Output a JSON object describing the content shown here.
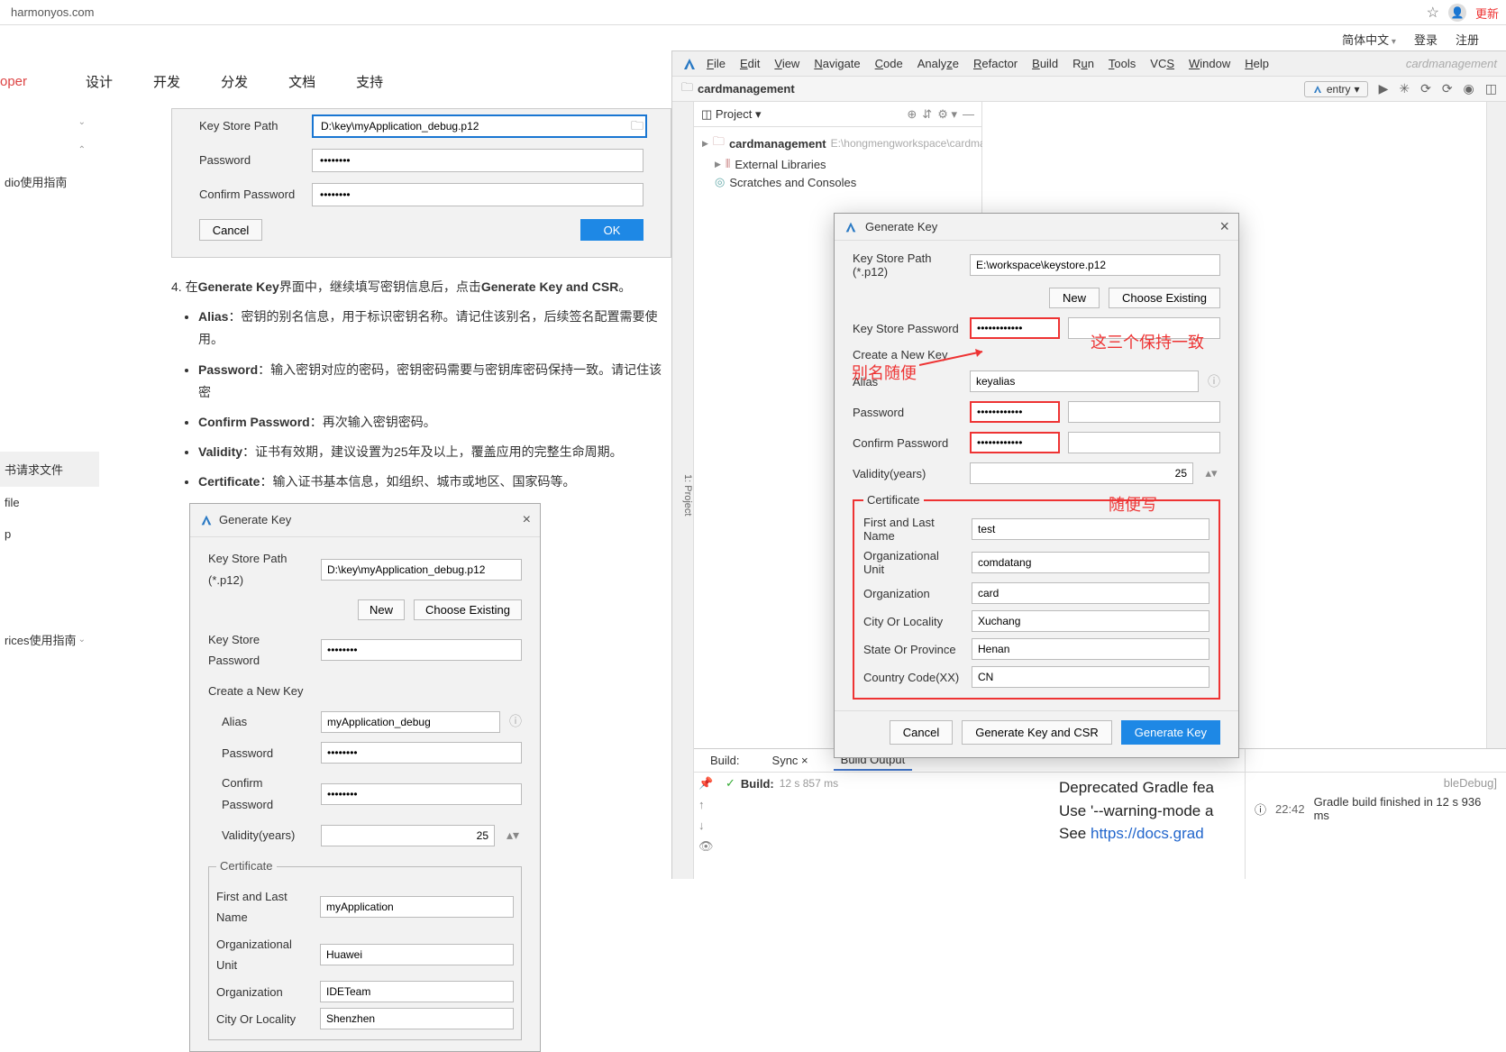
{
  "browser": {
    "url": "harmonyos.com",
    "update": "更新"
  },
  "top_nav": {
    "lang": "简体中文",
    "login": "登录",
    "register": "注册"
  },
  "dev_header": {
    "oper": "oper",
    "items": [
      "设计",
      "开发",
      "分发",
      "文档",
      "支持"
    ]
  },
  "left_sidebar": {
    "items": [
      {
        "label": "dio使用指南"
      },
      {
        "label": "书请求文件"
      },
      {
        "label": "file"
      },
      {
        "label": "p"
      },
      {
        "label": "rices使用指南"
      }
    ]
  },
  "doc": {
    "dialog1": {
      "label_keystore": "Key Store Path",
      "val_keystore": "D:\\key\\myApplication_debug.p12",
      "label_password": "Password",
      "val_password": "••••••••",
      "label_confirm": "Confirm Password",
      "val_confirm": "••••••••",
      "cancel": "Cancel",
      "ok": "OK"
    },
    "step_prefix": "4. 在",
    "step_bold1": "Generate Key",
    "step_mid": "界面中，继续填写密钥信息后，点击",
    "step_bold2": "Generate Key and CSR",
    "step_suffix": "。",
    "bullets": [
      {
        "b": "Alias",
        "t": "：密钥的别名信息，用于标识密钥名称。请记住该别名，后续签名配置需要使用。"
      },
      {
        "b": "Password",
        "t": "：输入密钥对应的密码，密钥密码需要与密钥库密码保持一致。请记住该密"
      },
      {
        "b": "Confirm Password",
        "t": "：再次输入密钥密码。"
      },
      {
        "b": "Validity",
        "t": "：证书有效期，建议设置为25年及以上，覆盖应用的完整生命周期。"
      },
      {
        "b": "Certificate",
        "t": "：输入证书基本信息，如组织、城市或地区、国家码等。"
      }
    ],
    "dialog2": {
      "title": "Generate Key",
      "label_keystore_path": "Key Store Path (*.p12)",
      "val_keystore_path": "D:\\key\\myApplication_debug.p12",
      "btn_new": "New",
      "btn_choose": "Choose Existing",
      "label_ks_password": "Key Store Password",
      "val_ks_password": "••••••••",
      "label_create": "Create a New Key",
      "label_alias": "Alias",
      "val_alias": "myApplication_debug",
      "label_password": "Password",
      "val_password": "••••••••",
      "label_confirm": "Confirm Password",
      "val_confirm": "••••••••",
      "label_validity": "Validity(years)",
      "val_validity": "25",
      "fieldset_title": "Certificate",
      "label_name": "First and Last Name",
      "val_name": "myApplication",
      "label_ou": "Organizational Unit",
      "val_ou": "Huawei",
      "label_org": "Organization",
      "val_org": "IDETeam",
      "label_city": "City Or Locality",
      "val_city": "Shenzhen"
    }
  },
  "ide": {
    "menu": [
      "File",
      "Edit",
      "View",
      "Navigate",
      "Code",
      "Analyze",
      "Refactor",
      "Build",
      "Run",
      "Tools",
      "VCS",
      "Window",
      "Help"
    ],
    "project_name": "cardmanagement",
    "breadcrumb": "cardmanagement",
    "run_config": "entry",
    "left_gutter": "1: Project",
    "project_header": "Project",
    "tree": {
      "root": "cardmanagement",
      "root_path": "E:\\hongmengworkspace\\cardmanagem",
      "ext_libs": "External Libraries",
      "scratches": "Scratches and Consoles"
    },
    "build": {
      "tab1": "Build:",
      "tab2": "Sync",
      "tab3": "Build Output",
      "status_label": "Build:",
      "status_time": "12 s 857 ms",
      "console_l1": "Deprecated Gradle fea",
      "console_l2": "Use '--warning-mode a",
      "console_l3": "See ",
      "console_link": "https://docs.grad",
      "right_badge": "bleDebug]",
      "right_time": "22:42",
      "right_msg": "Gradle build finished in 12 s 936 ms"
    }
  },
  "gen_dialog": {
    "title": "Generate Key",
    "label_path": "Key Store Path (*.p12)",
    "val_path": "E:\\workspace\\keystore.p12",
    "btn_new": "New",
    "btn_choose": "Choose Existing",
    "label_ks_pwd": "Key Store Password",
    "val_ks_pwd": "••••••••••••",
    "label_create": "Create a New Key",
    "label_alias": "Alias",
    "val_alias": "keyalias",
    "label_pwd": "Password",
    "val_pwd": "••••••••••••",
    "label_confirm": "Confirm Password",
    "val_confirm": "••••••••••••",
    "label_validity": "Validity(years)",
    "val_validity": "25",
    "fieldset_title": "Certificate",
    "label_name": "First and Last Name",
    "val_name": "test",
    "label_ou": "Organizational Unit",
    "val_ou": "comdatang",
    "label_org": "Organization",
    "val_org": "card",
    "label_city": "City Or Locality",
    "val_city": "Xuchang",
    "label_state": "State Or Province",
    "val_state": "Henan",
    "label_country": "Country Code(XX)",
    "val_country": "CN",
    "btn_cancel": "Cancel",
    "btn_gen_csr": "Generate Key and CSR",
    "btn_gen": "Generate Key"
  },
  "annotations": {
    "a1": "这三个保持一致",
    "a2": "别名随便",
    "a3": "随便写"
  }
}
